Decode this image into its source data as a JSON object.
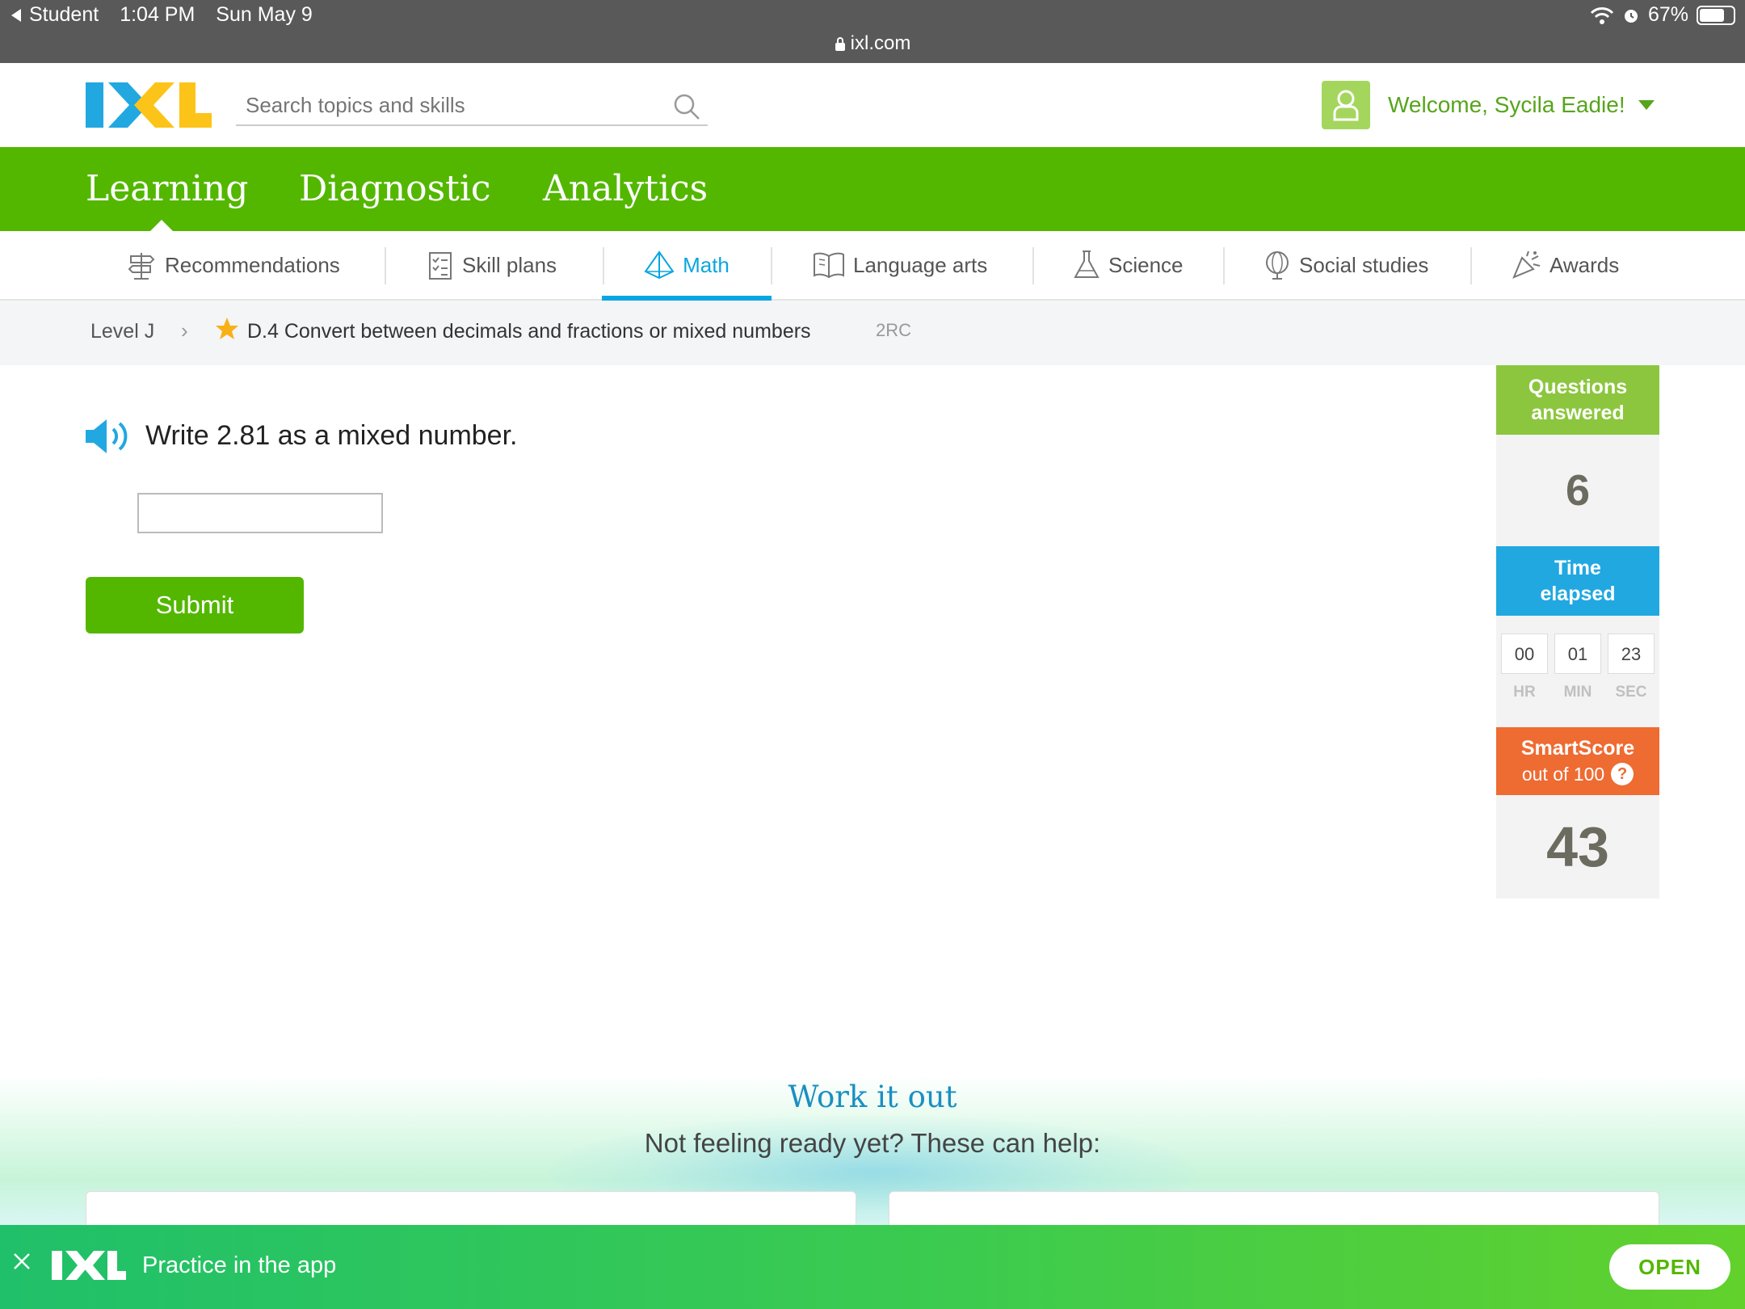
{
  "status_bar": {
    "back_app": "Student",
    "time": "1:04 PM",
    "date": "Sun May 9",
    "url": "ixl.com",
    "battery": "67%"
  },
  "header": {
    "search_placeholder": "Search topics and skills",
    "welcome": "Welcome, Sycila Eadie!"
  },
  "main_nav": {
    "tabs": [
      {
        "label": "Learning",
        "active": true
      },
      {
        "label": "Diagnostic"
      },
      {
        "label": "Analytics"
      }
    ]
  },
  "subject_nav": {
    "tabs": [
      {
        "label": "Recommendations",
        "icon": "signpost-icon"
      },
      {
        "label": "Skill plans",
        "icon": "checklist-icon"
      },
      {
        "label": "Math",
        "icon": "pyramid-icon",
        "active": true
      },
      {
        "label": "Language arts",
        "icon": "book-icon"
      },
      {
        "label": "Science",
        "icon": "flask-icon"
      },
      {
        "label": "Social studies",
        "icon": "globe-icon"
      },
      {
        "label": "Awards",
        "icon": "party-popper-icon"
      }
    ]
  },
  "breadcrumb": {
    "level": "Level J",
    "skill": "D.4 Convert between decimals and fractions or mixed numbers",
    "code": "2RC"
  },
  "question": {
    "prompt": "Write 2.81 as a mixed number.",
    "answer_value": "",
    "submit_label": "Submit"
  },
  "stats": {
    "questions_answered_line1": "Questions",
    "questions_answered_line2": "answered",
    "questions_answered_value": "6",
    "time_elapsed_line1": "Time",
    "time_elapsed_line2": "elapsed",
    "time": {
      "hr": "00",
      "min": "01",
      "sec": "23"
    },
    "time_labels": {
      "hr": "HR",
      "min": "MIN",
      "sec": "SEC"
    },
    "smartscore_title": "SmartScore",
    "smartscore_sub": "out of 100",
    "smartscore_help": "?",
    "smartscore_value": "43"
  },
  "work_it_out": {
    "title": "Work it out",
    "subtitle": "Not feeling ready yet? These can help:"
  },
  "app_banner": {
    "text": "Practice in the app",
    "open_label": "OPEN"
  },
  "colors": {
    "brand_green": "#53b700",
    "math_blue": "#0aa6e0",
    "questions_green": "#8cc63e",
    "time_blue": "#21a8e1",
    "smartscore_orange": "#ee6b32"
  }
}
